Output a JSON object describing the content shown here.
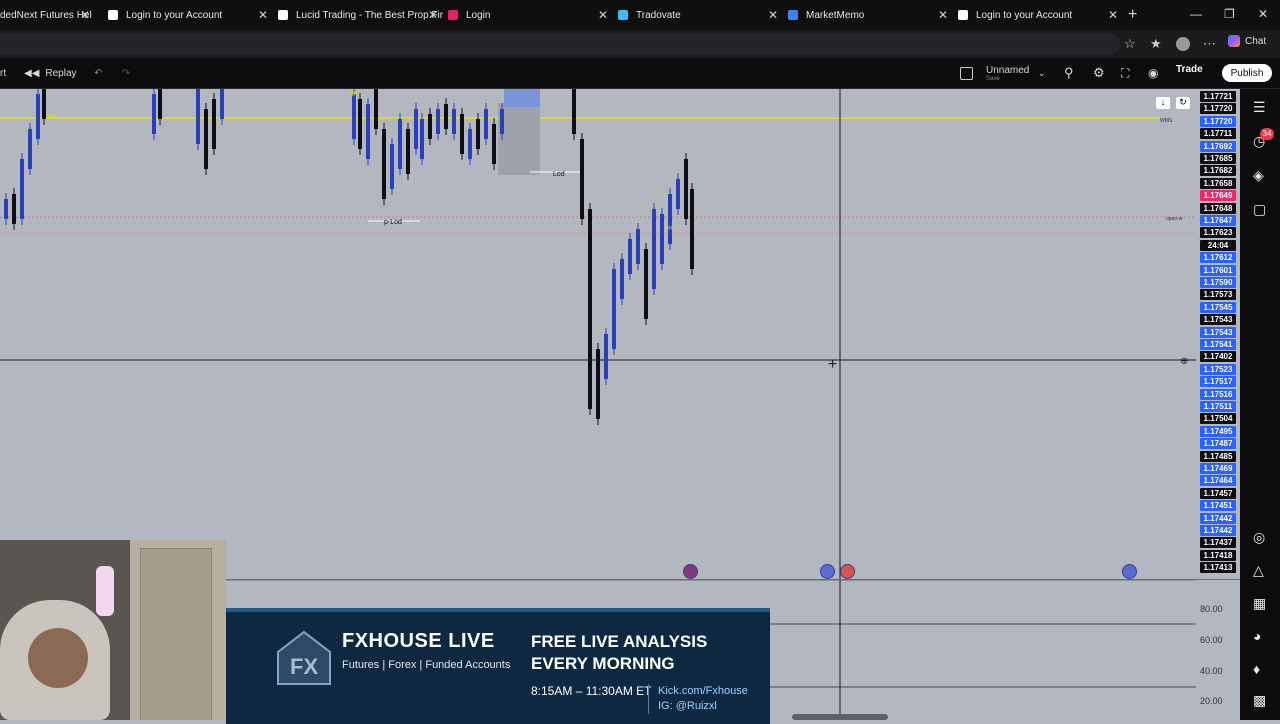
{
  "browser": {
    "tabs": [
      {
        "title": "dedNext Futures Hel",
        "fav_color": "#3b82f6"
      },
      {
        "title": "Login to your Account",
        "fav_color": "#ffffff"
      },
      {
        "title": "Lucid Trading - The Best Prop Fir",
        "fav_color": "#ffffff"
      },
      {
        "title": "Login",
        "fav_color": "#e91e63"
      },
      {
        "title": "Tradovate",
        "fav_color": "#38bdf8"
      },
      {
        "title": "MarketMemo",
        "fav_color": "#3b82f6"
      },
      {
        "title": "Login to your Account",
        "fav_color": "#ffffff"
      }
    ],
    "new_tab": "+",
    "chat_label": "Chat"
  },
  "toolbar": {
    "left_label": "rt",
    "replay_label": "Replay",
    "layout_name": "Unnamed",
    "layout_sub": "Save",
    "trade_label": "Trade",
    "publish_label": "Publish"
  },
  "chart": {
    "level_labels": {
      "lod": "Lod",
      "plod": "p-Lod",
      "tag_4h": "4H"
    },
    "wms_label": "WMS",
    "open_label": "open-w"
  },
  "price_scale": {
    "labels": [
      {
        "text": "1.17721",
        "style": "black"
      },
      {
        "text": "1.17720",
        "style": "black"
      },
      {
        "text": "1.17720",
        "style": "blue"
      },
      {
        "text": "1.17711",
        "style": "black"
      },
      {
        "text": "1.17692",
        "style": "blue"
      },
      {
        "text": "1.17685",
        "style": "black"
      },
      {
        "text": "1.17682",
        "style": "black"
      },
      {
        "text": "1.17658",
        "style": "black"
      },
      {
        "text": "1.17649",
        "style": "red"
      },
      {
        "text": "1.17648",
        "style": "black"
      },
      {
        "text": "1.17647",
        "style": "blue"
      },
      {
        "text": "1.17623",
        "style": "black"
      },
      {
        "text": "24:04",
        "style": "black"
      },
      {
        "text": "1.17612",
        "style": "blue"
      },
      {
        "text": "1.17601",
        "style": "blue"
      },
      {
        "text": "1.17590",
        "style": "blue"
      },
      {
        "text": "1.17573",
        "style": "black"
      },
      {
        "text": "1.17545",
        "style": "blue"
      },
      {
        "text": "1.17543",
        "style": "black"
      },
      {
        "text": "1.17543",
        "style": "blue"
      },
      {
        "text": "1.17541",
        "style": "blue"
      },
      {
        "text": "1.17402",
        "style": "black"
      },
      {
        "text": "1.17523",
        "style": "blue"
      },
      {
        "text": "1.17517",
        "style": "blue"
      },
      {
        "text": "1.17516",
        "style": "blue"
      },
      {
        "text": "1.17511",
        "style": "blue"
      },
      {
        "text": "1.17504",
        "style": "black"
      },
      {
        "text": "1.17495",
        "style": "blue"
      },
      {
        "text": "1.17487",
        "style": "blue"
      },
      {
        "text": "1.17485",
        "style": "black"
      },
      {
        "text": "1.17469",
        "style": "blue"
      },
      {
        "text": "1.17464",
        "style": "blue"
      },
      {
        "text": "1.17457",
        "style": "black"
      },
      {
        "text": "1.17451",
        "style": "blue"
      },
      {
        "text": "1.17442",
        "style": "blue"
      },
      {
        "text": "1.17442",
        "style": "blue"
      },
      {
        "text": "1.17437",
        "style": "black"
      },
      {
        "text": "1.17418",
        "style": "black"
      },
      {
        "text": "1.17413",
        "style": "black"
      }
    ]
  },
  "oscillator": {
    "levels": [
      "80.00",
      "60.00",
      "40.00",
      "20.00"
    ]
  },
  "right_sidebar": {
    "alert_count": "34"
  },
  "banner": {
    "brand": "FXHOUSE LIVE",
    "subtitle": "Futures | Forex | Funded Accounts",
    "headline_1": "FREE LIVE ANALYSIS",
    "headline_2": "EVERY MORNING",
    "time": "8:15AM – 11:30AM ET",
    "kick": "Kick.com/Fxhouse",
    "ig": "IG: @Ruizxl"
  }
}
